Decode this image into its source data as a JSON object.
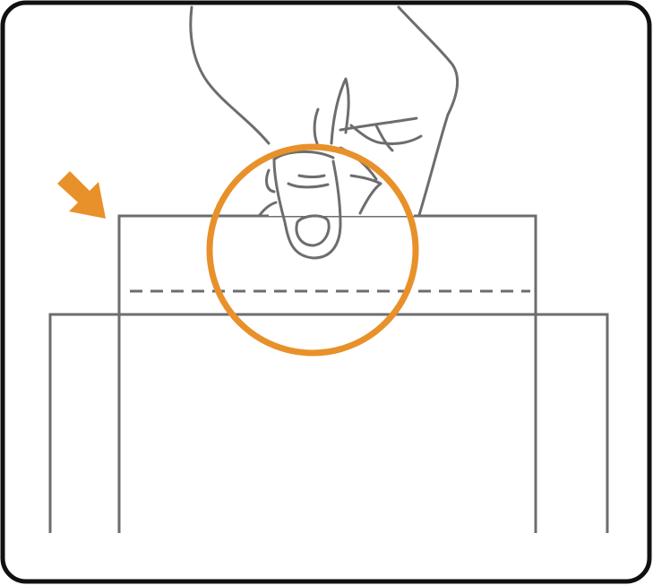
{
  "illustration": {
    "subject": "fingers-pinching-top-of-packet",
    "icons": {
      "hand": "hand-pinch-icon",
      "arrow": "arrow-down-right-icon",
      "highlight": "highlight-circle-icon"
    },
    "colors": {
      "background": "#ffffff",
      "border": "#111111",
      "line": "#6d6d6d",
      "accent": "#e8912a"
    }
  }
}
